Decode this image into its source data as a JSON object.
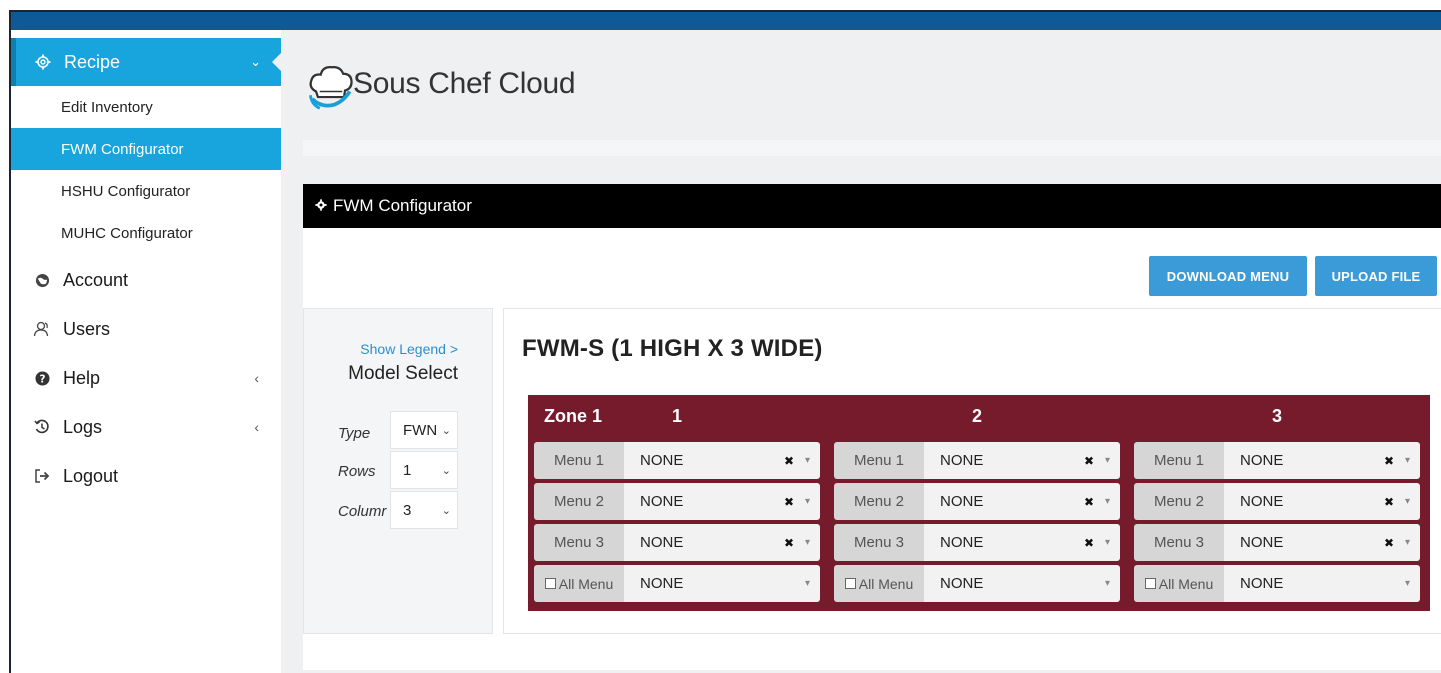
{
  "app": {
    "title": "Sous Chef Cloud"
  },
  "sidebar": {
    "recipe": {
      "label": "Recipe",
      "icon": "gear-icon"
    },
    "sub_items": [
      {
        "label": "Edit Inventory",
        "active": false
      },
      {
        "label": "FWM Configurator",
        "active": true
      },
      {
        "label": "HSHU Configurator",
        "active": false
      },
      {
        "label": "MUHC Configurator",
        "active": false
      }
    ],
    "items": [
      {
        "label": "Account",
        "icon": "globe-icon",
        "chevron": false
      },
      {
        "label": "Users",
        "icon": "users-icon",
        "chevron": false
      },
      {
        "label": "Help",
        "icon": "question-icon",
        "chevron": true
      },
      {
        "label": "Logs",
        "icon": "history-icon",
        "chevron": true
      },
      {
        "label": "Logout",
        "icon": "logout-icon",
        "chevron": false
      }
    ]
  },
  "panel": {
    "title": "FWM Configurator",
    "download_label": "DOWNLOAD MENU",
    "upload_label": "UPLOAD FILE"
  },
  "model_select": {
    "legend_link": "Show Legend >",
    "title": "Model Select",
    "type_label": "Type",
    "type_value": "FWN",
    "rows_label": "Rows",
    "rows_value": "1",
    "columns_label": "Columr",
    "columns_value": "3"
  },
  "grid": {
    "title": "FWM-S (1 HIGH X 3 WIDE)",
    "zone_label": "Zone 1",
    "columns": [
      "1",
      "2",
      "3"
    ],
    "row_labels": [
      "Menu 1",
      "Menu 2",
      "Menu 3",
      "All Menu"
    ],
    "cells": [
      [
        "NONE",
        "NONE",
        "NONE",
        "NONE"
      ],
      [
        "NONE",
        "NONE",
        "NONE",
        "NONE"
      ],
      [
        "NONE",
        "NONE",
        "NONE",
        "NONE"
      ]
    ]
  },
  "colors": {
    "topbar": "#0e5a96",
    "accent": "#18a4dc",
    "button": "#3b9ad8",
    "zone": "#761b2c"
  }
}
